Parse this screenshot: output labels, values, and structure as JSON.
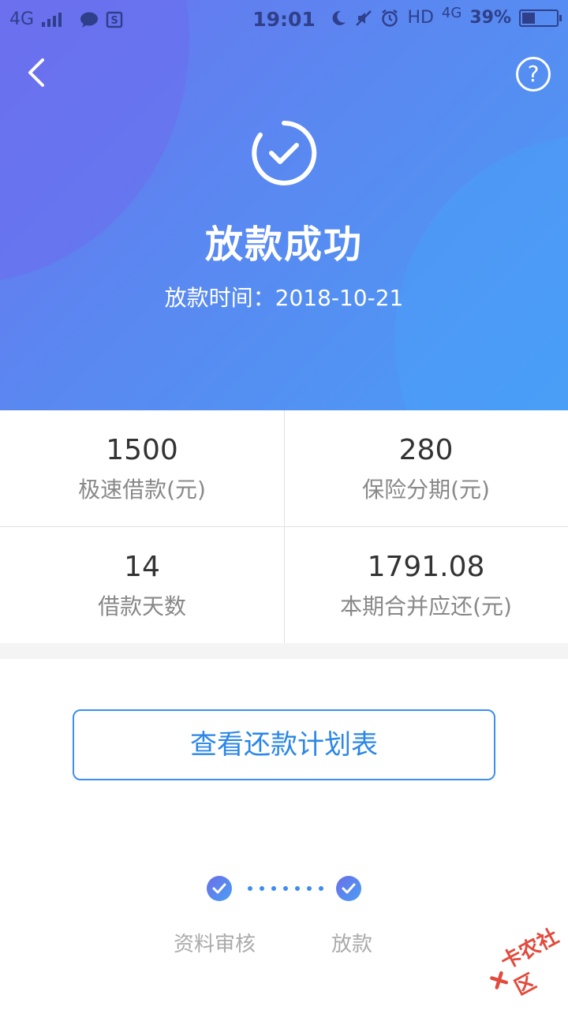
{
  "status_bar": {
    "network": "4G",
    "time": "19:01",
    "hd": "HD",
    "network_right": "4G",
    "battery": "39%",
    "battery_level": 0.39
  },
  "header": {
    "title": "放款成功",
    "subtitle": "放款时间：2018-10-21"
  },
  "stats": [
    {
      "value": "1500",
      "label": "极速借款(元)"
    },
    {
      "value": "280",
      "label": "保险分期(元)"
    },
    {
      "value": "14",
      "label": "借款天数"
    },
    {
      "value": "1791.08",
      "label": "本期合并应还(元)"
    }
  ],
  "plan_button": {
    "label": "查看还款计划表"
  },
  "steps": [
    {
      "label": "资料审核",
      "status": "done"
    },
    {
      "label": "放款",
      "status": "done"
    }
  ],
  "watermark": {
    "text": "卡农社区"
  },
  "colors": {
    "accent": "#3d8ef0",
    "header_start": "#6a74ee",
    "header_end": "#4a9cf5"
  }
}
